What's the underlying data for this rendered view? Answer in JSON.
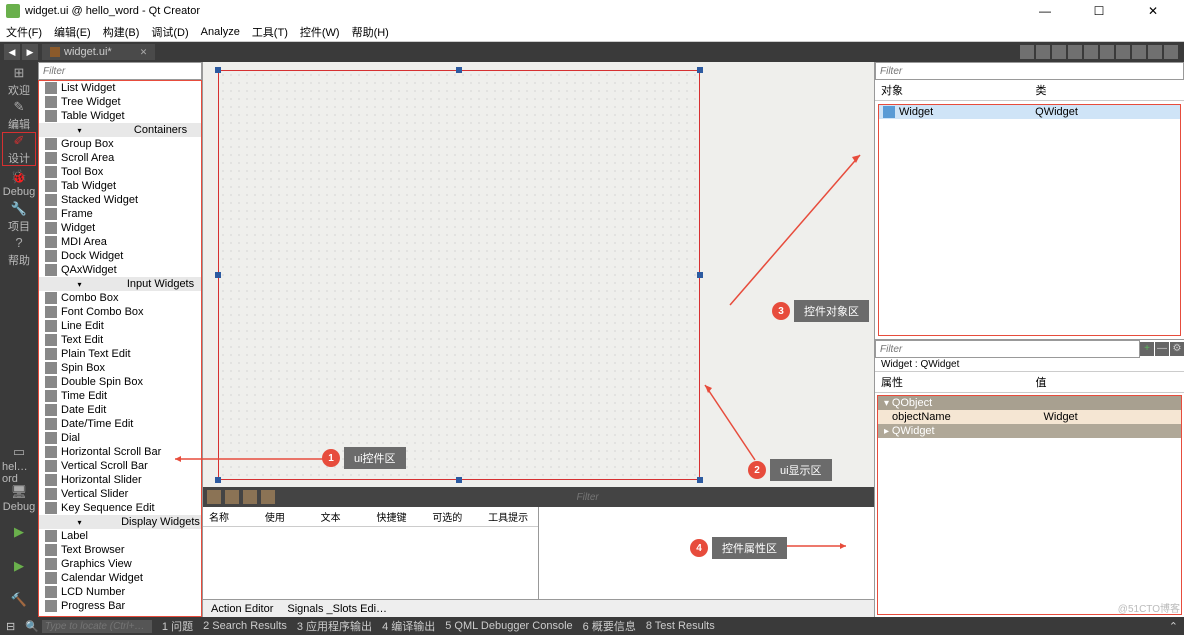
{
  "window": {
    "title": "widget.ui @ hello_word - Qt Creator",
    "min": "—",
    "max": "☐",
    "close": "✕"
  },
  "menu": [
    "文件(F)",
    "编辑(E)",
    "构建(B)",
    "调试(D)",
    "Analyze",
    "工具(T)",
    "控件(W)",
    "帮助(H)"
  ],
  "open_doc": {
    "name": "widget.ui*"
  },
  "modes": [
    {
      "label": "欢迎",
      "icon": "⊞"
    },
    {
      "label": "编辑",
      "icon": "✎"
    },
    {
      "label": "设计",
      "icon": "✐",
      "active": true
    },
    {
      "label": "Debug",
      "icon": "🐞"
    },
    {
      "label": "项目",
      "icon": "⚙"
    },
    {
      "label": "帮助",
      "icon": "?"
    }
  ],
  "bottom_modes": [
    {
      "label": "hel…ord",
      "icon": "▭"
    },
    {
      "label": "Debug",
      "icon": "🖥"
    },
    {
      "label": "",
      "icon": "▶",
      "color": "#6ab04c"
    },
    {
      "label": "",
      "icon": "▶",
      "color": "#d35400"
    },
    {
      "label": "",
      "icon": "🔨",
      "color": "#888"
    }
  ],
  "filter_placeholder": "Filter",
  "widget_box": {
    "items_top": [
      "List Widget",
      "Tree Widget",
      "Table Widget"
    ],
    "cat_containers": "Containers",
    "items_containers": [
      "Group Box",
      "Scroll Area",
      "Tool Box",
      "Tab Widget",
      "Stacked Widget",
      "Frame",
      "Widget",
      "MDI Area",
      "Dock Widget",
      "QAxWidget"
    ],
    "cat_input": "Input Widgets",
    "items_input": [
      "Combo Box",
      "Font Combo Box",
      "Line Edit",
      "Text Edit",
      "Plain Text Edit",
      "Spin Box",
      "Double Spin Box",
      "Time Edit",
      "Date Edit",
      "Date/Time Edit",
      "Dial",
      "Horizontal Scroll Bar",
      "Vertical Scroll Bar",
      "Horizontal Slider",
      "Vertical Slider",
      "Key Sequence Edit"
    ],
    "cat_display": "Display Widgets",
    "items_display": [
      "Label",
      "Text Browser",
      "Graphics View",
      "Calendar Widget",
      "LCD Number",
      "Progress Bar"
    ]
  },
  "action_editor": {
    "cols": [
      "名称",
      "使用",
      "文本",
      "快捷键",
      "可选的",
      "工具提示"
    ],
    "tab1": "Action Editor",
    "tab2": "Signals _Slots Edi…"
  },
  "object_inspector": {
    "hdr_obj": "对象",
    "hdr_cls": "类",
    "row_obj": "Widget",
    "row_cls": "QWidget"
  },
  "property_editor": {
    "class_line": "Widget : QWidget",
    "hdr_prop": "属性",
    "hdr_val": "值",
    "section1": "QObject",
    "row1_name": "objectName",
    "row1_val": "Widget",
    "section2": "QWidget"
  },
  "annotations": {
    "a1": "ui控件区",
    "a2": "ui显示区",
    "a3": "控件对象区",
    "a4": "控件属性区"
  },
  "status": {
    "search_placeholder": "Type to locate (Ctrl+…",
    "items": [
      "1 问题",
      "2 Search Results",
      "3 应用程序输出",
      "4 编译输出",
      "5 QML Debugger Console",
      "6 概要信息",
      "8 Test Results"
    ]
  },
  "watermark": "@51CTO博客"
}
